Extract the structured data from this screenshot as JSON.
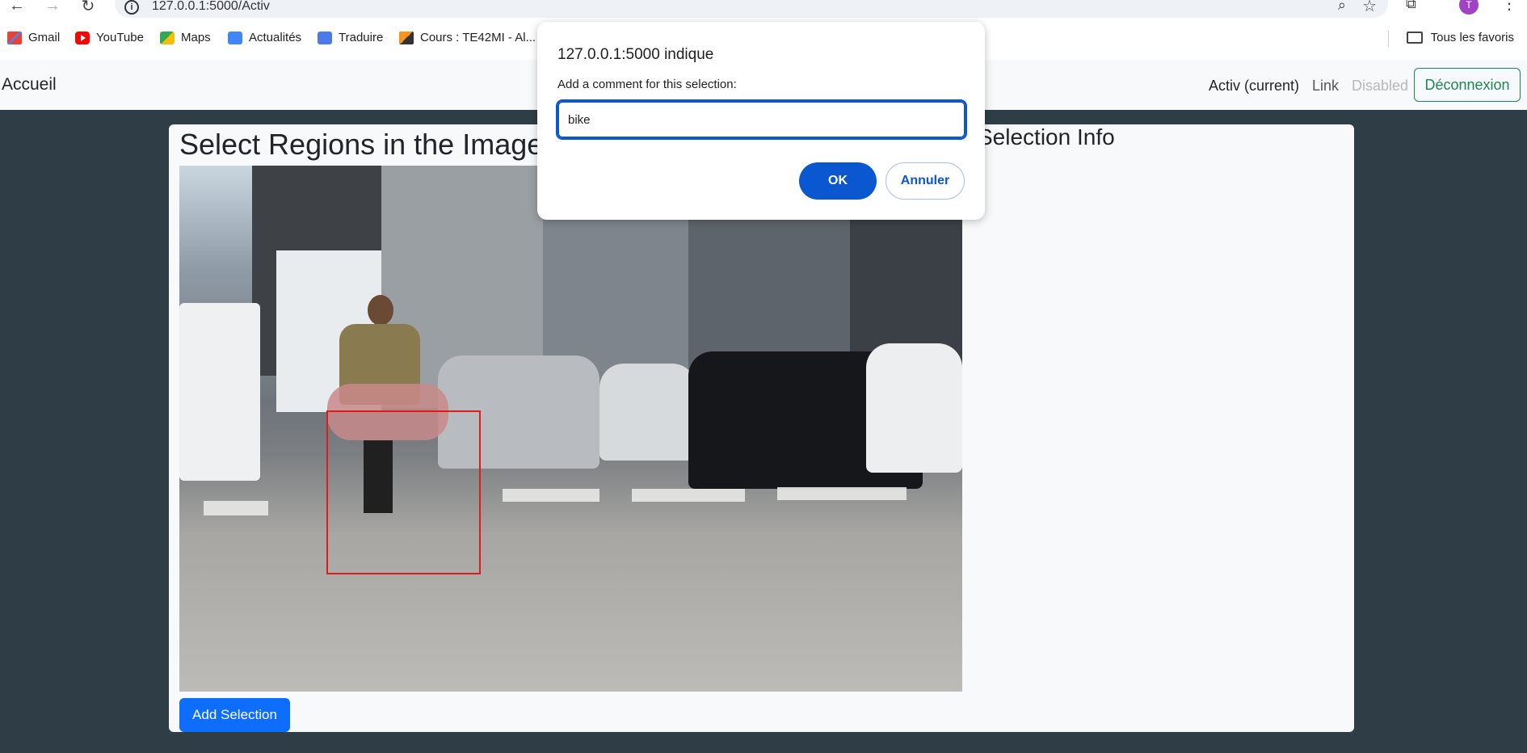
{
  "browser": {
    "url": "127.0.0.1:5000/Activ",
    "profile_initial": "T",
    "bookmarks": [
      {
        "label": "Gmail",
        "icon": "gmail-icon"
      },
      {
        "label": "YouTube",
        "icon": "youtube-icon"
      },
      {
        "label": "Maps",
        "icon": "maps-icon"
      },
      {
        "label": "Actualités",
        "icon": "news-icon"
      },
      {
        "label": "Traduire",
        "icon": "translate-icon"
      },
      {
        "label": "Cours : TE42MI - Al...",
        "icon": "course-icon"
      }
    ],
    "all_bookmarks_label": "Tous les favoris"
  },
  "navbar": {
    "brand": "Accueil",
    "links": [
      {
        "label": "Activ (current)",
        "state": "active"
      },
      {
        "label": "Link",
        "state": "normal"
      },
      {
        "label": "Disabled",
        "state": "disabled"
      }
    ],
    "logout_label": "Déconnexion"
  },
  "main": {
    "title": "Select Regions in the Image",
    "side_title": "Selection Info",
    "add_button_label": "Add Selection"
  },
  "dialog": {
    "title": "127.0.0.1:5000 indique",
    "message": "Add a comment for this selection:",
    "input_value": "bike",
    "ok_label": "OK",
    "cancel_label": "Annuler"
  },
  "colors": {
    "page_bg": "#2f3e46",
    "primary": "#0d6efd",
    "success": "#198754",
    "dialog_accent": "#0b57d0",
    "selection": "#e01b1b"
  }
}
